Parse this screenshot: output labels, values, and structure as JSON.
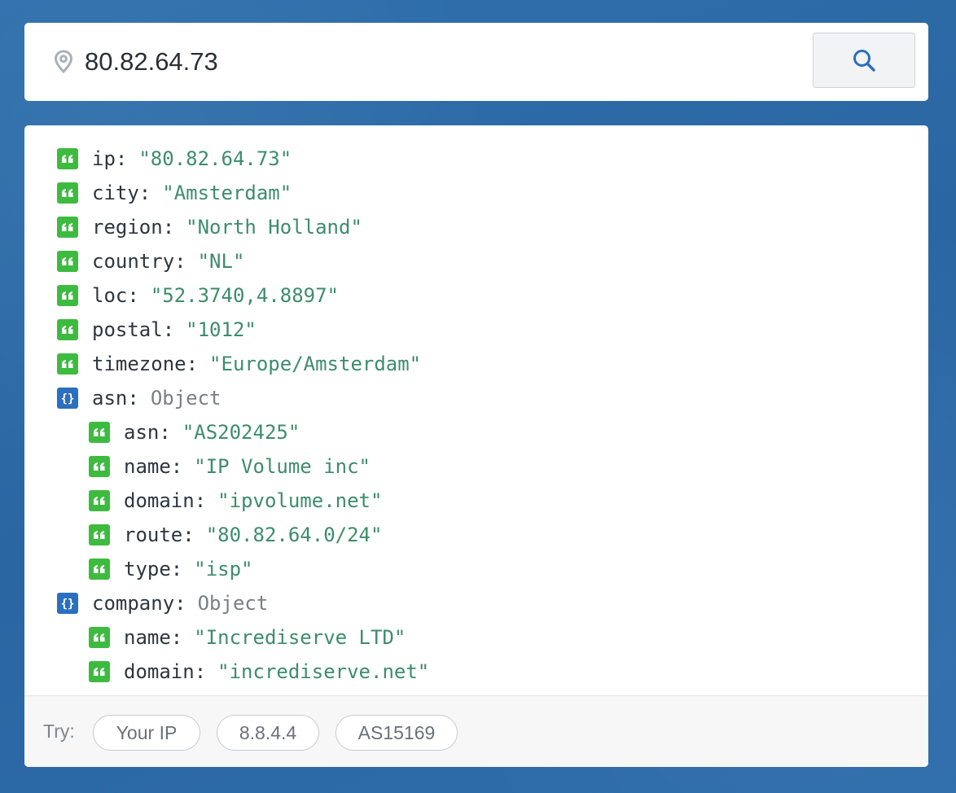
{
  "search": {
    "value": "80.82.64.73",
    "placeholder": "",
    "pin_icon": "map-pin-icon",
    "button_icon": "search-icon"
  },
  "result": {
    "ip": {
      "key": "ip",
      "value": "\"80.82.64.73\""
    },
    "city": {
      "key": "city",
      "value": "\"Amsterdam\""
    },
    "region": {
      "key": "region",
      "value": "\"North Holland\""
    },
    "country": {
      "key": "country",
      "value": "\"NL\""
    },
    "loc": {
      "key": "loc",
      "value": "\"52.3740,4.8897\""
    },
    "postal": {
      "key": "postal",
      "value": "\"1012\""
    },
    "timezone": {
      "key": "timezone",
      "value": "\"Europe/Amsterdam\""
    },
    "asn": {
      "key": "asn",
      "value": "Object",
      "children": {
        "asn": {
          "key": "asn",
          "value": "\"AS202425\""
        },
        "name": {
          "key": "name",
          "value": "\"IP Volume inc\""
        },
        "domain": {
          "key": "domain",
          "value": "\"ipvolume.net\""
        },
        "route": {
          "key": "route",
          "value": "\"80.82.64.0/24\""
        },
        "type": {
          "key": "type",
          "value": "\"isp\""
        }
      }
    },
    "company": {
      "key": "company",
      "value": "Object",
      "children": {
        "name": {
          "key": "name",
          "value": "\"Incrediserve LTD\""
        },
        "domain": {
          "key": "domain",
          "value": "\"incrediserve.net\""
        }
      }
    }
  },
  "footer": {
    "try_label": "Try:",
    "chips": [
      "Your IP",
      "8.8.4.4",
      "AS15169"
    ]
  },
  "colors": {
    "background": "#2b6aa8",
    "string_badge": "#3dbb3f",
    "object_badge": "#2a6fc0",
    "string_value": "#3c8d6c",
    "search_icon": "#2a6fc0"
  }
}
